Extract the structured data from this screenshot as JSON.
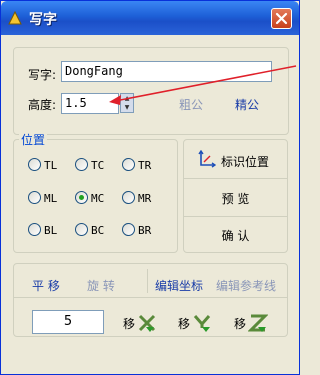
{
  "window": {
    "title": "写字"
  },
  "text_group": {
    "text_label": "写字:",
    "text_value": "DongFang",
    "height_label": "高度:",
    "height_value": "1.5",
    "thick_label": "粗公",
    "fine_label": "精公"
  },
  "position_group": {
    "title": "位置",
    "options": [
      "TL",
      "TC",
      "TR",
      "ML",
      "MC",
      "MR",
      "BL",
      "BC",
      "BR"
    ],
    "selected": "MC"
  },
  "actions": {
    "mark_position": "标识位置",
    "preview": "预  览",
    "confirm": "确  认"
  },
  "tools": {
    "tabs": [
      "平 移",
      "旋 转",
      "编辑坐标",
      "编辑参考线"
    ],
    "step_value": "5",
    "move_label": "移",
    "move_axes": [
      "x-axis",
      "y-axis",
      "z-axis"
    ]
  },
  "colors": {
    "title_bar": "#1d5fd6",
    "accent_link": "#1a3da8",
    "arrow": "#e0202a"
  }
}
